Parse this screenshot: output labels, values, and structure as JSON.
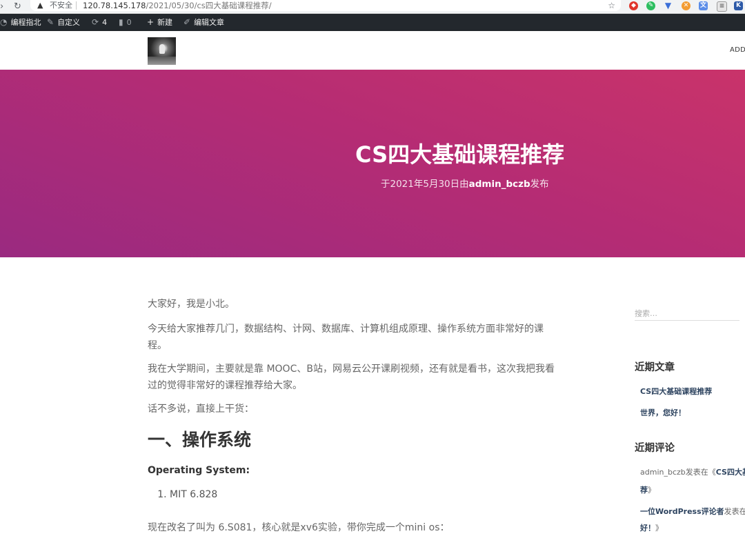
{
  "browser": {
    "insecure_label": "不安全",
    "url_host": "120.78.145.178",
    "url_path": "/2021/05/30/cs四大基础课程推荐/"
  },
  "adminbar": {
    "site_name": "编程指北",
    "customize": "自定义",
    "updates_count": "4",
    "comments_count": "0",
    "new": "新建",
    "edit_post": "编辑文章"
  },
  "header": {
    "nav_item": "ADD"
  },
  "post": {
    "title": "CS四大基础课程推荐",
    "meta_prefix": "于2021年5月30日由",
    "author": "admin_bczb",
    "meta_suffix": "发布"
  },
  "content": {
    "p1": "大家好，我是小北。",
    "p2": "今天给大家推荐几门，数据结构、计网、数据库、计算机组成原理、操作系统方面非常好的课程。",
    "p3": "我在大学期间，主要就是靠 MOOC、B站，网易云公开课刷视频，还有就是看书，这次我把我看过的觉得非常好的课程推荐给大家。",
    "p4": "话不多说，直接上干货：",
    "h_os": "一、操作系统",
    "h_os_en": "Operating System:",
    "list_item_1": "MIT 6.828",
    "p5": "现在改名了叫为 6.S081，核心就是xv6实验，带你完成一个mini os："
  },
  "sidebar": {
    "search_placeholder": "搜索…",
    "recent_posts_title": "近期文章",
    "recent_posts": [
      "CS四大基础课程推荐",
      "世界，您好！"
    ],
    "recent_comments_title": "近期评论",
    "comment1_author": "admin_bczb",
    "comment1_mid": "发表在《",
    "comment1_post_a": "CS四大基",
    "comment1_post_b": "荐",
    "comment1_end": "》",
    "comment2_author": "一位WordPress评论者",
    "comment2_mid": "发表在《",
    "comment2_post": "好！",
    "comment2_end": "》"
  },
  "colors": {
    "hero_start": "#c9336a",
    "hero_end": "#9a2a80",
    "adminbar_bg": "#23282d",
    "link": "#2e4460"
  }
}
